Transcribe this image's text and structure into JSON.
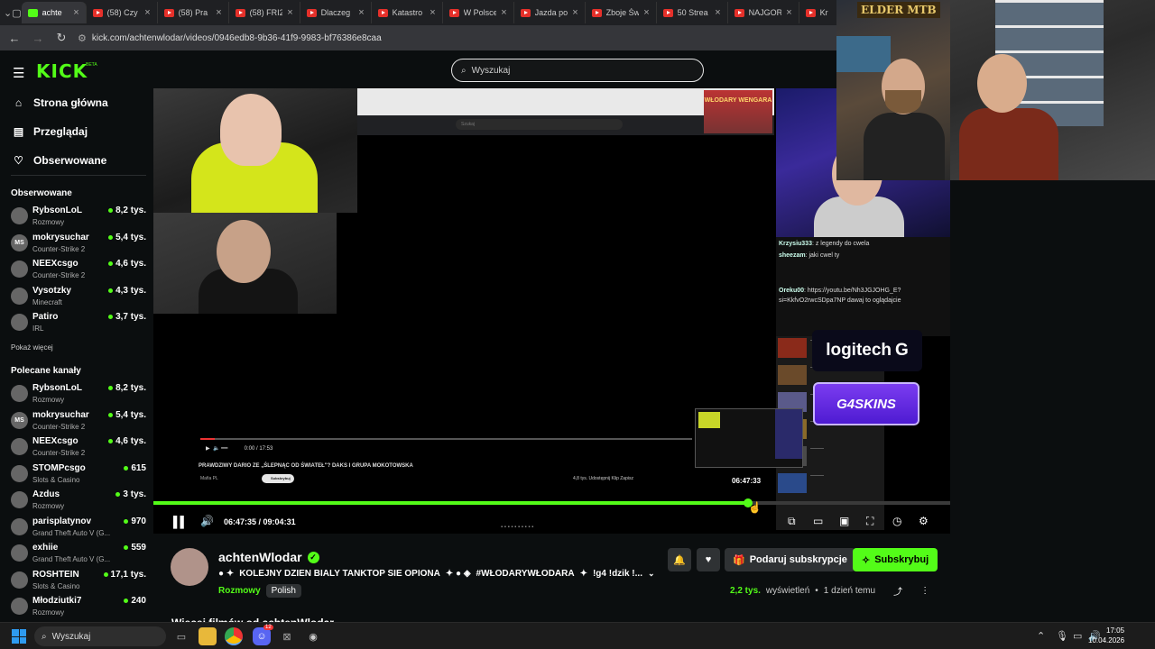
{
  "browser": {
    "tabs": [
      {
        "label": "achte",
        "active": true
      },
      {
        "label": "(58) Czy"
      },
      {
        "label": "(58) Pra"
      },
      {
        "label": "(58) FRI2"
      },
      {
        "label": "Dlaczeg"
      },
      {
        "label": "Katastro"
      },
      {
        "label": "W Polsce"
      },
      {
        "label": "Jazda po"
      },
      {
        "label": "Zboje Św"
      },
      {
        "label": "50 Strea"
      },
      {
        "label": "NAJGOR"
      },
      {
        "label": "Kr"
      }
    ],
    "url": "kick.com/achtenwlodar/videos/0946edb8-9b36-41f9-9983-bf76386e8caa"
  },
  "header": {
    "logo": "KICK",
    "logo_badge": "BETA",
    "search_placeholder": "Wyszukaj"
  },
  "sidebar": {
    "nav": [
      {
        "label": "Strona główna",
        "icon": "home-icon"
      },
      {
        "label": "Przeglądaj",
        "icon": "browse-icon"
      },
      {
        "label": "Obserwowane",
        "icon": "heart-icon"
      }
    ],
    "followed_title": "Obserwowane",
    "followed": [
      {
        "name": "RybsonLoL",
        "category": "Rozmowy",
        "viewers": "8,2 tys."
      },
      {
        "name": "mokrysuchar",
        "category": "Counter-Strike 2",
        "viewers": "5,4 tys.",
        "initials": "MS"
      },
      {
        "name": "NEEXcsgo",
        "category": "Counter-Strike 2",
        "viewers": "4,6 tys."
      },
      {
        "name": "Vysotzky",
        "category": "Minecraft",
        "viewers": "4,3 tys."
      },
      {
        "name": "Patiro",
        "category": "IRL",
        "viewers": "3,7 tys."
      }
    ],
    "show_more": "Pokaż więcej",
    "recommended_title": "Polecane kanały",
    "recommended": [
      {
        "name": "RybsonLoL",
        "category": "Rozmowy",
        "viewers": "8,2 tys."
      },
      {
        "name": "mokrysuchar",
        "category": "Counter-Strike 2",
        "viewers": "5,4 tys.",
        "initials": "MS"
      },
      {
        "name": "NEEXcsgo",
        "category": "Counter-Strike 2",
        "viewers": "4,6 tys."
      },
      {
        "name": "STOMPcsgo",
        "category": "Slots & Casino",
        "viewers": "615"
      },
      {
        "name": "Azdus",
        "category": "Rozmowy",
        "viewers": "3 tys."
      },
      {
        "name": "parisplatynov",
        "category": "Grand Theft Auto V (G...",
        "viewers": "970"
      },
      {
        "name": "exhiie",
        "category": "Grand Theft Auto V (G...",
        "viewers": "559"
      },
      {
        "name": "ROSHTEIN",
        "category": "Slots & Casino",
        "viewers": "17,1 tys."
      },
      {
        "name": "Młodziutki7",
        "category": "Rozmowy",
        "viewers": "240"
      }
    ]
  },
  "video": {
    "inner_title": "PRAWDZIWY DARIO ZE „ŚLEPNĄC OD ŚWIATEŁ\"? DAKS I GRUPA MOKOTOWSKA",
    "inner_channel": "Mafia PL",
    "inner_subscribe": "Subskrybuj",
    "inner_time": "0:00 / 17:53",
    "inner_search": "Szukaj",
    "inner_tools": "4,8 tys.    Udostępnij    Klip    Zapisz",
    "banner": "WŁODARY WENGARA",
    "chat": [
      {
        "user": "Krzysiu333",
        "text": ": z legendy do cwela"
      },
      {
        "user": "sheezam",
        "text": ": jaki cwel ty"
      },
      {
        "user": "Oreku00",
        "text": ": https://youtu.be/Nh3JGJOHG_E?si=KkfvO2rwcSDpa7NP dawaj to oglądajcie"
      }
    ],
    "logitech": "logitech",
    "g4skins": "G4SKINS",
    "preview_time": "06:47:33",
    "elapsed": "06:47:35",
    "duration": "09:04:31",
    "progress": 0.7464
  },
  "overlay": {
    "facecam_logo": "ELDER MTB"
  },
  "channel": {
    "name": "achtenWlodar",
    "verified": true,
    "title": "KOLEJNY DZIEN BIALY TANKTOP SIE OPIONA",
    "title_rest": "#WŁODARYWŁODARA",
    "title_tail": "!g4 !dzik !...",
    "category": "Rozmowy",
    "language": "Polish",
    "gift_label": "Podaruj subskrypcje",
    "subscribe_label": "Subskrybuj",
    "views": "2,2 tys.",
    "views_suffix": "wyświetleń",
    "date": "1 dzień temu",
    "more_videos": "Więcej filmów od achtenWlodar"
  },
  "taskbar": {
    "search": "Wyszukaj",
    "time": "17:05",
    "date": "10.04.2026",
    "discord_badge": "12"
  },
  "colors": {
    "kick_green": "#53fc18",
    "background": "#0b0e0f"
  }
}
